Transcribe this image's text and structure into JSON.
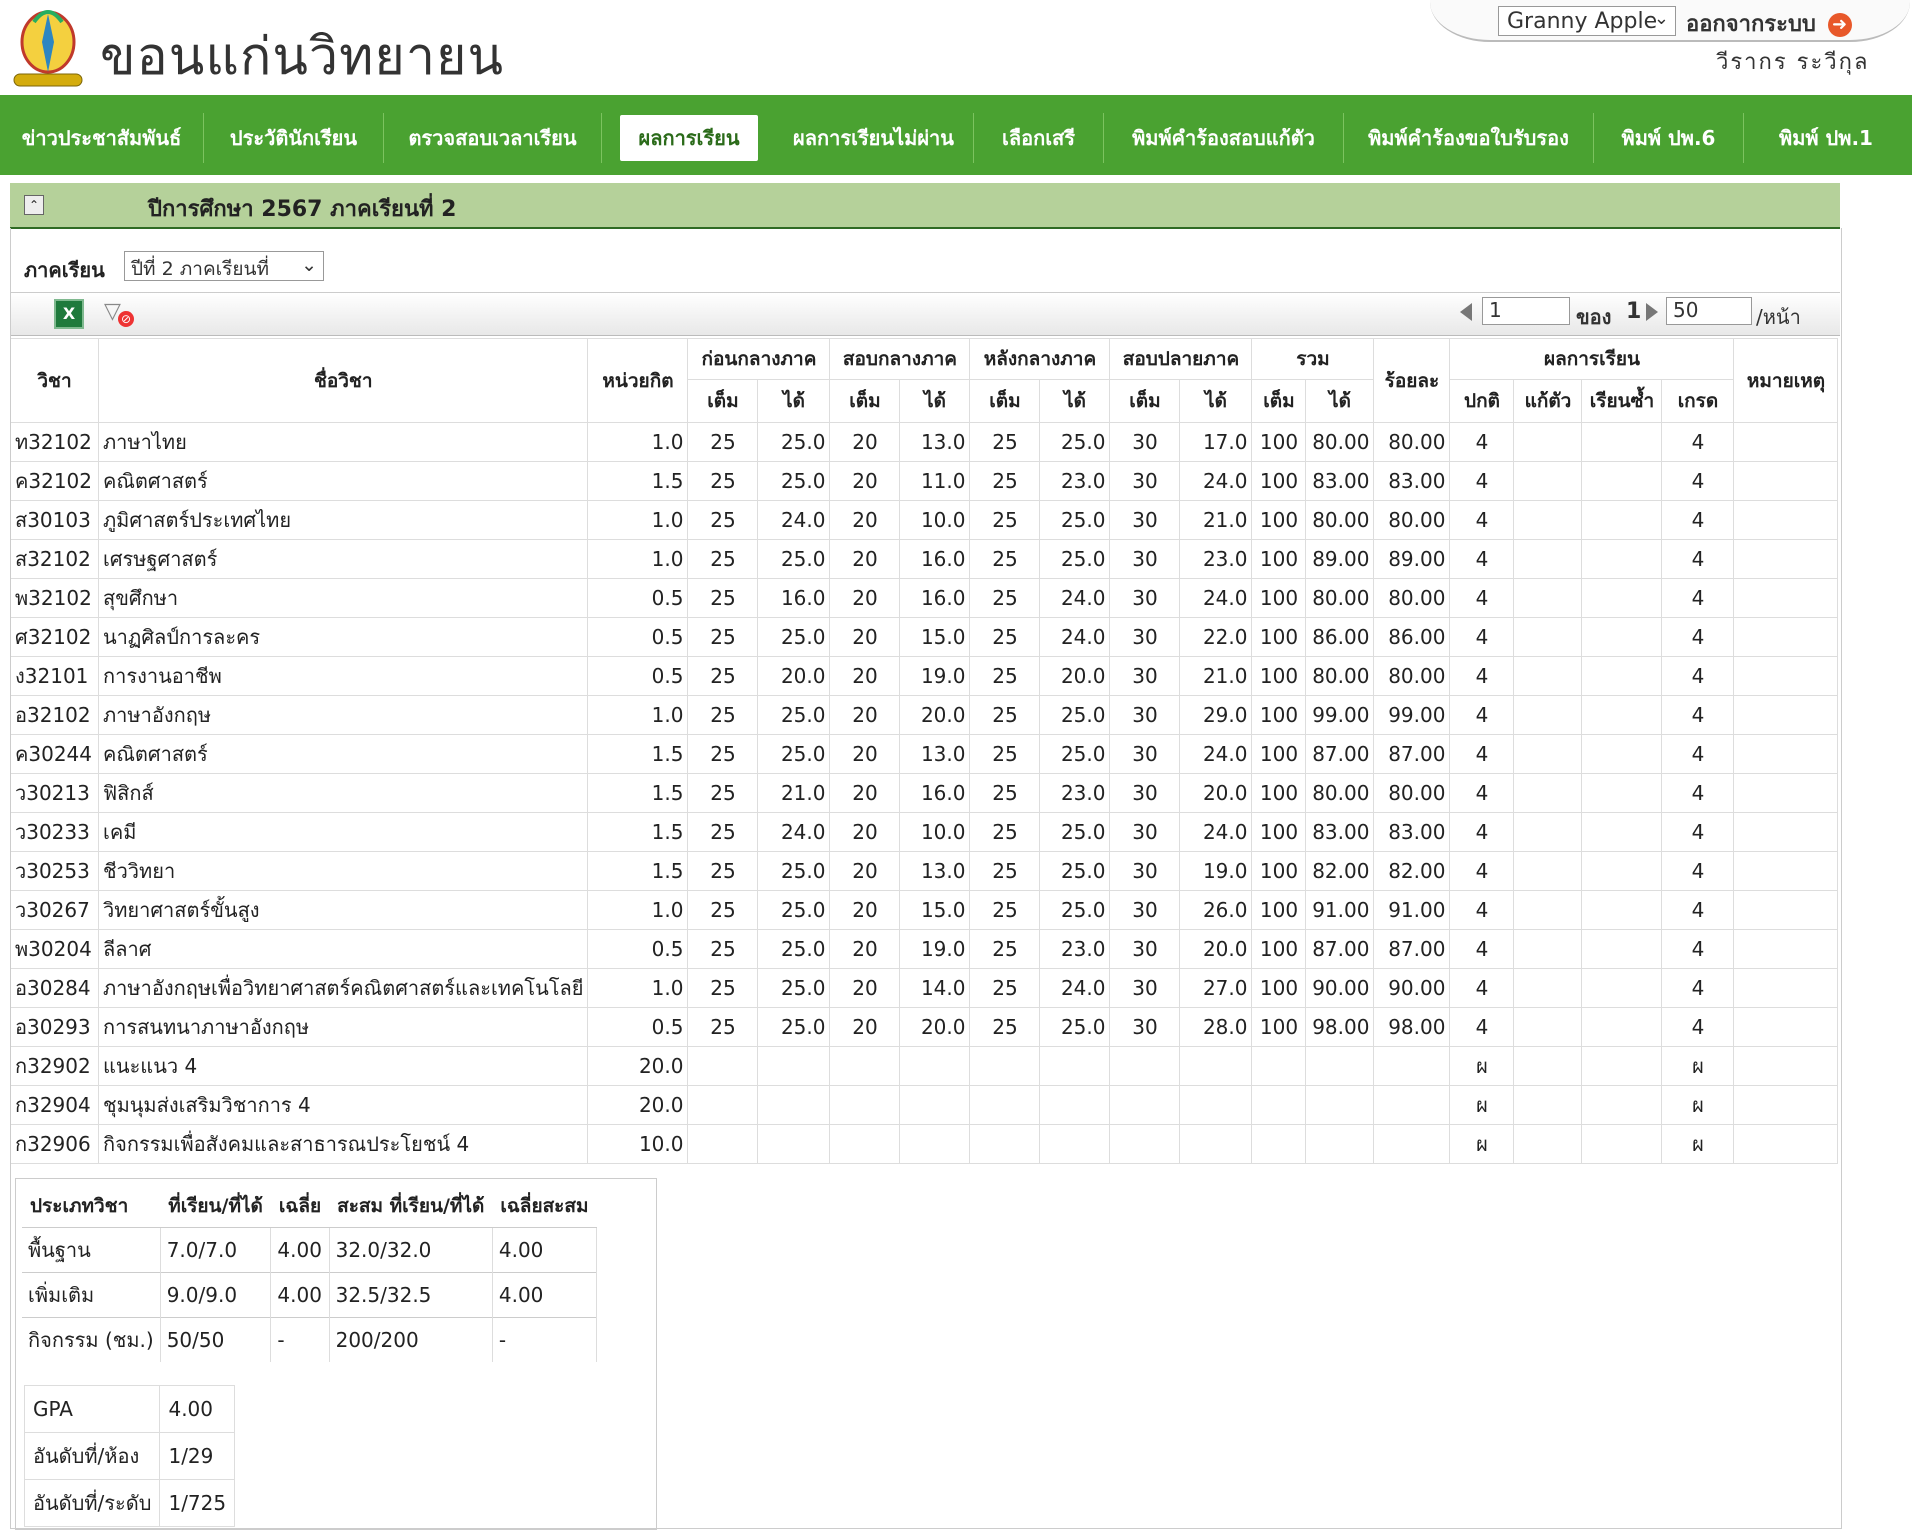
{
  "header": {
    "site_title": "ขอนแก่นวิทยายน",
    "user_select_value": "Granny Apple",
    "logout_label": "ออกจากระบบ",
    "user_name": "วีรากร ระวีกุล"
  },
  "nav": [
    "ข่าวประชาสัมพันธ์",
    "ประวัตินักเรียน",
    "ตรวจสอบเวลาเรียน",
    "ผลการเรียน",
    "ผลการเรียนไม่ผ่าน",
    "เลือกเสรี",
    "พิมพ์คำร้องสอบแก้ตัว",
    "พิมพ์คำร้องขอใบรับรอง",
    "พิมพ์ ปพ.6",
    "พิมพ์ ปพ.1"
  ],
  "term_bar": {
    "title": "ปีการศึกษา 2567 ภาคเรียนที่ 2"
  },
  "term_filter": {
    "label": "ภาคเรียน",
    "value": "ปีที่ 2 ภาคเรียนที่"
  },
  "pager": {
    "page": "1",
    "of_label": "ของ",
    "total": "1",
    "page_size": "50",
    "unit": "/หน้า"
  },
  "table": {
    "headers": {
      "code": "วิชา",
      "name": "ชื่อวิชา",
      "credit": "หน่วยกิต",
      "pre_mid": "ก่อนกลางภาค",
      "mid": "สอบกลางภาค",
      "post_mid": "หลังกลางภาค",
      "final": "สอบปลายภาค",
      "total": "รวม",
      "percent": "ร้อยละ",
      "result": "ผลการเรียน",
      "note": "หมายเหตุ",
      "full": "เต็ม",
      "got": "ได้",
      "normal": "ปกติ",
      "remedial": "แก้ตัว",
      "repeat": "เรียนซ้ำ",
      "grade": "เกรด"
    },
    "rows": [
      [
        "ท32102",
        "ภาษาไทย",
        "1.0",
        "25",
        "25.0",
        "20",
        "13.0",
        "25",
        "25.0",
        "30",
        "17.0",
        "100",
        "80.00",
        "80.00",
        "4",
        "",
        "",
        "4",
        ""
      ],
      [
        "ค32102",
        "คณิตศาสตร์",
        "1.5",
        "25",
        "25.0",
        "20",
        "11.0",
        "25",
        "23.0",
        "30",
        "24.0",
        "100",
        "83.00",
        "83.00",
        "4",
        "",
        "",
        "4",
        ""
      ],
      [
        "ส30103",
        "ภูมิศาสตร์ประเทศไทย",
        "1.0",
        "25",
        "24.0",
        "20",
        "10.0",
        "25",
        "25.0",
        "30",
        "21.0",
        "100",
        "80.00",
        "80.00",
        "4",
        "",
        "",
        "4",
        ""
      ],
      [
        "ส32102",
        "เศรษฐศาสตร์",
        "1.0",
        "25",
        "25.0",
        "20",
        "16.0",
        "25",
        "25.0",
        "30",
        "23.0",
        "100",
        "89.00",
        "89.00",
        "4",
        "",
        "",
        "4",
        ""
      ],
      [
        "พ32102",
        "สุขศึกษา",
        "0.5",
        "25",
        "16.0",
        "20",
        "16.0",
        "25",
        "24.0",
        "30",
        "24.0",
        "100",
        "80.00",
        "80.00",
        "4",
        "",
        "",
        "4",
        ""
      ],
      [
        "ศ32102",
        "นาฏศิลป์การละคร",
        "0.5",
        "25",
        "25.0",
        "20",
        "15.0",
        "25",
        "24.0",
        "30",
        "22.0",
        "100",
        "86.00",
        "86.00",
        "4",
        "",
        "",
        "4",
        ""
      ],
      [
        "ง32101",
        "การงานอาชีพ",
        "0.5",
        "25",
        "20.0",
        "20",
        "19.0",
        "25",
        "20.0",
        "30",
        "21.0",
        "100",
        "80.00",
        "80.00",
        "4",
        "",
        "",
        "4",
        ""
      ],
      [
        "อ32102",
        "ภาษาอังกฤษ",
        "1.0",
        "25",
        "25.0",
        "20",
        "20.0",
        "25",
        "25.0",
        "30",
        "29.0",
        "100",
        "99.00",
        "99.00",
        "4",
        "",
        "",
        "4",
        ""
      ],
      [
        "ค30244",
        "คณิตศาสตร์",
        "1.5",
        "25",
        "25.0",
        "20",
        "13.0",
        "25",
        "25.0",
        "30",
        "24.0",
        "100",
        "87.00",
        "87.00",
        "4",
        "",
        "",
        "4",
        ""
      ],
      [
        "ว30213",
        "ฟิสิกส์",
        "1.5",
        "25",
        "21.0",
        "20",
        "16.0",
        "25",
        "23.0",
        "30",
        "20.0",
        "100",
        "80.00",
        "80.00",
        "4",
        "",
        "",
        "4",
        ""
      ],
      [
        "ว30233",
        "เคมี",
        "1.5",
        "25",
        "24.0",
        "20",
        "10.0",
        "25",
        "25.0",
        "30",
        "24.0",
        "100",
        "83.00",
        "83.00",
        "4",
        "",
        "",
        "4",
        ""
      ],
      [
        "ว30253",
        "ชีววิทยา",
        "1.5",
        "25",
        "25.0",
        "20",
        "13.0",
        "25",
        "25.0",
        "30",
        "19.0",
        "100",
        "82.00",
        "82.00",
        "4",
        "",
        "",
        "4",
        ""
      ],
      [
        "ว30267",
        "วิทยาศาสตร์ขั้นสูง",
        "1.0",
        "25",
        "25.0",
        "20",
        "15.0",
        "25",
        "25.0",
        "30",
        "26.0",
        "100",
        "91.00",
        "91.00",
        "4",
        "",
        "",
        "4",
        ""
      ],
      [
        "พ30204",
        "ลีลาศ",
        "0.5",
        "25",
        "25.0",
        "20",
        "19.0",
        "25",
        "23.0",
        "30",
        "20.0",
        "100",
        "87.00",
        "87.00",
        "4",
        "",
        "",
        "4",
        ""
      ],
      [
        "อ30284",
        "ภาษาอังกฤษเพื่อวิทยาศาสตร์คณิตศาสตร์และเทคโนโลยี",
        "1.0",
        "25",
        "25.0",
        "20",
        "14.0",
        "25",
        "24.0",
        "30",
        "27.0",
        "100",
        "90.00",
        "90.00",
        "4",
        "",
        "",
        "4",
        ""
      ],
      [
        "อ30293",
        "การสนทนาภาษาอังกฤษ",
        "0.5",
        "25",
        "25.0",
        "20",
        "20.0",
        "25",
        "25.0",
        "30",
        "28.0",
        "100",
        "98.00",
        "98.00",
        "4",
        "",
        "",
        "4",
        ""
      ],
      [
        "ก32902",
        "แนะแนว 4",
        "20.0",
        "",
        "",
        "",
        "",
        "",
        "",
        "",
        "",
        "",
        "",
        "",
        "ผ",
        "",
        "",
        "ผ",
        ""
      ],
      [
        "ก32904",
        "ชุมนุมส่งเสริมวิชาการ 4",
        "20.0",
        "",
        "",
        "",
        "",
        "",
        "",
        "",
        "",
        "",
        "",
        "",
        "ผ",
        "",
        "",
        "ผ",
        ""
      ],
      [
        "ก32906",
        "กิจกรรมเพื่อสังคมและสาธารณประโยชน์ 4",
        "10.0",
        "",
        "",
        "",
        "",
        "",
        "",
        "",
        "",
        "",
        "",
        "",
        "ผ",
        "",
        "",
        "ผ",
        ""
      ]
    ]
  },
  "summary": {
    "headers": [
      "ประเภทวิชา",
      "ที่เรียน/ที่ได้",
      "เฉลี่ย",
      "สะสม ที่เรียน/ที่ได้",
      "เฉลี่ยสะสม"
    ],
    "rows": [
      [
        "พื้นฐาน",
        "7.0/7.0",
        "4.00",
        "32.0/32.0",
        "4.00"
      ],
      [
        "เพิ่มเติม",
        "9.0/9.0",
        "4.00",
        "32.5/32.5",
        "4.00"
      ],
      [
        "กิจกรรม (ชม.)",
        "50/50",
        "-",
        "200/200",
        "-"
      ]
    ],
    "gpa": [
      [
        "GPA",
        "4.00"
      ],
      [
        "อันดับที่/ห้อง",
        "1/29"
      ],
      [
        "อันดับที่/ระดับ",
        "1/725"
      ]
    ]
  }
}
